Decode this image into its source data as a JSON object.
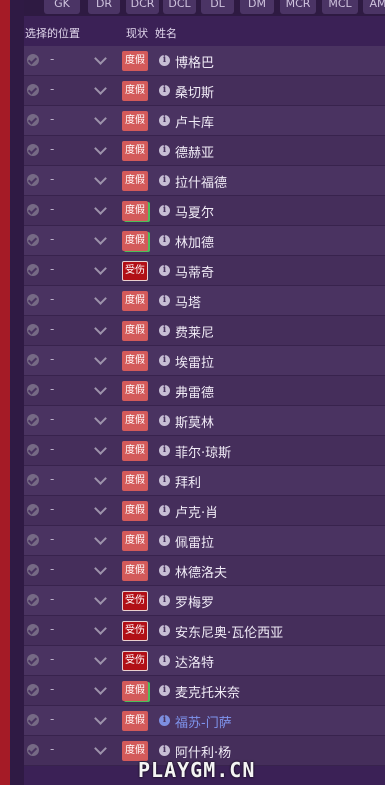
{
  "position_tabs": [
    "GK",
    "DR",
    "DCR",
    "DCL",
    "DL",
    "DM",
    "MCR",
    "MCL",
    "AM"
  ],
  "header": {
    "selected_position": "选择的位置",
    "status": "现状",
    "name": "姓名"
  },
  "players": [
    {
      "position": "-",
      "status": "度假",
      "status_type": "holiday",
      "name": "博格巴"
    },
    {
      "position": "-",
      "status": "度假",
      "status_type": "holiday",
      "name": "桑切斯"
    },
    {
      "position": "-",
      "status": "度假",
      "status_type": "holiday",
      "name": "卢卡库"
    },
    {
      "position": "-",
      "status": "度假",
      "status_type": "holiday",
      "name": "德赫亚"
    },
    {
      "position": "-",
      "status": "度假",
      "status_type": "holiday",
      "name": "拉什福德"
    },
    {
      "position": "-",
      "status": "度假",
      "status_type": "holiday",
      "name": "马夏尔",
      "green": true
    },
    {
      "position": "-",
      "status": "度假",
      "status_type": "holiday",
      "name": "林加德",
      "green": true
    },
    {
      "position": "-",
      "status": "受伤",
      "status_type": "injured",
      "name": "马蒂奇"
    },
    {
      "position": "-",
      "status": "度假",
      "status_type": "holiday",
      "name": "马塔"
    },
    {
      "position": "-",
      "status": "度假",
      "status_type": "holiday",
      "name": "费莱尼"
    },
    {
      "position": "-",
      "status": "度假",
      "status_type": "holiday",
      "name": "埃雷拉"
    },
    {
      "position": "-",
      "status": "度假",
      "status_type": "holiday",
      "name": "弗雷德"
    },
    {
      "position": "-",
      "status": "度假",
      "status_type": "holiday",
      "name": "斯莫林"
    },
    {
      "position": "-",
      "status": "度假",
      "status_type": "holiday",
      "name": "菲尔·琼斯"
    },
    {
      "position": "-",
      "status": "度假",
      "status_type": "holiday",
      "name": "拜利"
    },
    {
      "position": "-",
      "status": "度假",
      "status_type": "holiday",
      "name": "卢克·肖"
    },
    {
      "position": "-",
      "status": "度假",
      "status_type": "holiday",
      "name": "佩雷拉"
    },
    {
      "position": "-",
      "status": "度假",
      "status_type": "holiday",
      "name": "林德洛夫"
    },
    {
      "position": "-",
      "status": "受伤",
      "status_type": "injured",
      "name": "罗梅罗"
    },
    {
      "position": "-",
      "status": "受伤",
      "status_type": "injured",
      "name": "安东尼奥·瓦伦西亚"
    },
    {
      "position": "-",
      "status": "受伤",
      "status_type": "injured",
      "name": "达洛特"
    },
    {
      "position": "-",
      "status": "度假",
      "status_type": "holiday",
      "name": "麦克托米奈",
      "green": true
    },
    {
      "position": "-",
      "status": "度假",
      "status_type": "holiday",
      "name": "福苏-门萨",
      "highlight": true
    },
    {
      "position": "-",
      "status": "度假",
      "status_type": "holiday",
      "name": "阿什利·杨"
    }
  ],
  "watermark": "PLAYGM.CN",
  "colors": {
    "background": "#3b2156",
    "row": "#4a3361",
    "holiday_badge": "#d35a5a",
    "injured_badge": "#b10f16",
    "link_name": "#7f94ee",
    "left_strip": "#a51b26"
  }
}
